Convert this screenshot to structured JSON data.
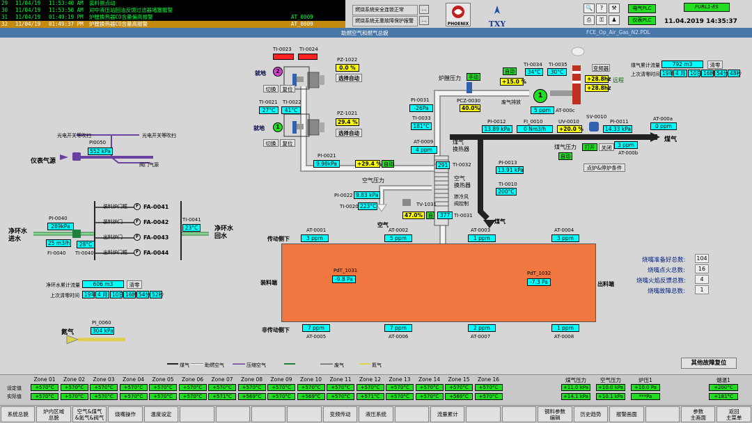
{
  "alarms": [
    {
      "n": "29",
      "date": "11/04/19",
      "time": "11:53:40 AM",
      "msg": "装料侧点动",
      "tag": ""
    },
    {
      "n": "30",
      "date": "11/04/19",
      "time": "11:53:50 AM",
      "msg": "对中液压站回油反馈过滤器堵塞报警",
      "tag": ""
    },
    {
      "n": "31",
      "date": "11/04/19",
      "time": "01:49:19 PM",
      "msg": "炉膛换热器CO含量偏高报警",
      "tag": "AT_0009"
    },
    {
      "n": "32",
      "date": "11/04/19",
      "time": "01:49:37 PM",
      "msg": "炉膛换热器CO含量高报警",
      "tag": "AT_0009"
    }
  ],
  "status_boxes": [
    "燃烧系统安全连锁正常",
    "燃烧系统无重故障保护报警"
  ],
  "dots": "...",
  "logo_left": "PHOENIX",
  "logo_right": "TXY",
  "plc": {
    "e": "电气PLC",
    "i": "仪表PLC"
  },
  "furl": "FURL1-ES",
  "datetime": "11.04.2019  14:35:37",
  "title": "助燃空气和燃气总貌",
  "pagecode": "FCE_Op_Air_Gas_N2.PDL",
  "burner_top": {
    "ti1": "TI-0023",
    "ti2": "TI-0024",
    "pz": "PZ-1022",
    "val": "0.0  %",
    "mode": "选择自动",
    "local": "就地",
    "num": "2",
    "b1": "切换",
    "b2": "复位"
  },
  "burner_mid": {
    "ti1": "TI-0021",
    "ti2": "TI-0022",
    "t1": "27°C",
    "t2": "41°C",
    "pz": "PZ-1021",
    "val": "29.4  %",
    "mode": "选择自动",
    "local": "就地",
    "num": "1",
    "b1": "切换",
    "b2": "复位"
  },
  "inst_air": {
    "pi": "PI0050",
    "val": "552  kPa",
    "label": "仪表气源",
    "l1": "光电开关等吹扫",
    "l2": "光电开关等吹扫",
    "l3": "阀门气源"
  },
  "water": {
    "pi": "PI-0040",
    "pval": "289kPa",
    "flow": "25  m3/h",
    "temp": "28°C",
    "fi": "FI-0040",
    "ti": "TI-0040",
    "ti2": "TI-0041",
    "t2": "23°C",
    "in": "净环水\n进水",
    "out": "净环水\n回水",
    "fa": [
      {
        "l": "装料炉门框",
        "t": "FA-0041"
      },
      {
        "l": "装料炉门",
        "t": "FA-0042"
      },
      {
        "l": "出料炉门",
        "t": "FA-0043"
      },
      {
        "l": "出料炉门框",
        "t": "FA-0044"
      }
    ],
    "acc_l": "净环水累计流量",
    "acc": "606  m3",
    "clear": "清零",
    "last_l": "上次清零时间",
    "last": [
      "19年",
      "4  月",
      "10日",
      "16时",
      "54分",
      "52秒"
    ]
  },
  "n2": {
    "pi": "PI_0060",
    "val": "304  kPa",
    "label": "氮气"
  },
  "air_main": {
    "pi21": "PI-0021",
    "v21": "9.98kPa",
    "pct": "+29.4 %",
    "auto": "自动",
    "air_p": "空气压力",
    "pi22": "PI-0022",
    "v22": "9.83 kPa",
    "ti20": "TI-0020",
    "v20": "223°C",
    "tv": "TV-1031",
    "tvv": "47.0%",
    "self": "自",
    "ti31": "TI-0031",
    "v31": "377",
    "air": "空气",
    "dilute": "掺冷风\n阀控制"
  },
  "furnace_p": {
    "l": "炉膛压力",
    "m": "手动",
    "pcz": "PCZ-0030",
    "v": "40.0%"
  },
  "pi31": {
    "t": "PI-0031",
    "v": "-26Pa"
  },
  "ti33": {
    "t": "TI-0033",
    "v": "181°C"
  },
  "at9": {
    "t": "AT-0009",
    "v": "4  ppm"
  },
  "hx": {
    "gas": "煤气\n换热器",
    "air": "空气\n换热器",
    "ti32": "TI-0032",
    "v32": "291"
  },
  "fan": {
    "auto": "自动",
    "pct": "+15.0 %",
    "ti34": "TI-0034",
    "v34": "34°C",
    "ti35": "TI-0035",
    "v35": "30°C",
    "exh": "废气排放",
    "ppm": "5  ppm",
    "at": "AT-000c",
    "num": "1"
  },
  "conv": {
    "l": "变频器",
    "h1": "+28.8hz",
    "h2": "+28.8hz",
    "r": "远程"
  },
  "gas_acc": {
    "l": "煤气累计流量",
    "v": "792  m3",
    "clear": "清零",
    "last_l": "上次清零时间",
    "last": [
      "19年",
      "4  月",
      "10日",
      "16时",
      "54分",
      "48秒"
    ]
  },
  "gas_line": {
    "pi12": "PI-0012",
    "v12": "13.89 kPa",
    "fi10": "FI_0010",
    "vf": "0 Nm3/h",
    "uv": "UV-0010",
    "vuv": "+20.0 %",
    "sv": "SV-0010",
    "pi11": "PI-0011",
    "v11": "14.33 kPa",
    "ata": "AT-000a",
    "va": "0  ppm",
    "atb": "AT-000b",
    "vb": "3  ppm",
    "gas": "煤气",
    "gp": "煤气压力",
    "auto": "自动",
    "open": "打开",
    "close": "关闭",
    "ign": "点炉&停炉条件",
    "pi13": "PI-0013",
    "v13": "13.91 kPa",
    "ti10": "TI-0010",
    "v10": "200°C",
    "gas2": "煤气"
  },
  "at_top": [
    {
      "t": "AT-0001",
      "v": "3  ppm"
    },
    {
      "t": "AT-0002",
      "v": "5  ppm"
    },
    {
      "t": "AT-0003",
      "v": "1  ppm"
    },
    {
      "t": "AT-0004",
      "v": "3  ppm"
    }
  ],
  "at_bot": [
    {
      "t": "AT-0005",
      "v": "7  ppm"
    },
    {
      "t": "AT-0006",
      "v": "7  ppm"
    },
    {
      "t": "AT-0007",
      "v": "2  ppm"
    },
    {
      "t": "AT-0008",
      "v": "1  ppm"
    }
  ],
  "furnace": {
    "drive": "传动侧下",
    "nondrive": "非传动侧下",
    "load": "装料端",
    "unload": "出料端",
    "pdt1": "PdT_1031",
    "p1": "-9.8 Pa",
    "pdt2": "PdT_1032",
    "p2": "-7.3 Pa"
  },
  "counts": [
    {
      "l": "烧嘴准备好总数:",
      "v": "104"
    },
    {
      "l": "烧嘴点火总数:",
      "v": "16"
    },
    {
      "l": "烧嘴火焰反馈总数:",
      "v": "4"
    },
    {
      "l": "烧嘴故障总数:",
      "v": "1"
    }
  ],
  "reset_all": "其他故障复位",
  "legend": [
    "煤气",
    "助燃空气",
    "压缩空气",
    "",
    "废气",
    "氮气"
  ],
  "zones": {
    "set_l": "设定值",
    "act_l": "实际值",
    "items": [
      {
        "h": "Zone 01",
        "s": "+570°C",
        "a": "+570°C"
      },
      {
        "h": "Zone 02",
        "s": "+570°C",
        "a": "+570°C"
      },
      {
        "h": "Zone 03",
        "s": "+570°C",
        "a": "+570°C"
      },
      {
        "h": "Zone 04",
        "s": "+570°C",
        "a": "+570°C"
      },
      {
        "h": "Zone 05",
        "s": "+570°C",
        "a": "+570°C"
      },
      {
        "h": "Zone 06",
        "s": "+570°C",
        "a": "+570°C"
      },
      {
        "h": "Zone 07",
        "s": "+570°C",
        "a": "+571°C"
      },
      {
        "h": "Zone 08",
        "s": "+570°C",
        "a": "+569°C"
      },
      {
        "h": "Zone 09",
        "s": "+570°C",
        "a": "+570°C"
      },
      {
        "h": "Zone 10",
        "s": "+570°C",
        "a": "+569°C"
      },
      {
        "h": "Zone 11",
        "s": "+570°C",
        "a": "+570°C"
      },
      {
        "h": "Zone 12",
        "s": "+570°C",
        "a": "+571°C"
      },
      {
        "h": "Zone 13",
        "s": "+570°C",
        "a": "+570°C"
      },
      {
        "h": "Zone 14",
        "s": "+570°C",
        "a": "+570°C"
      },
      {
        "h": "Zone 15",
        "s": "+570°C",
        "a": "+569°C"
      },
      {
        "h": "Zone 16",
        "s": "+570°C",
        "a": "+570°C"
      }
    ],
    "extra": [
      {
        "h": "煤气压力",
        "s": "+11.0 kPa",
        "a": "+14.1 kPa"
      },
      {
        "h": "空气压力",
        "s": "+10.0 kPa",
        "a": "+10.1 kPa"
      },
      {
        "h": "炉压1",
        "s": "+10.0 Pa",
        "a": "***Pa"
      },
      {
        "h": "烟温1",
        "s": "+200°C",
        "a": "+181°C"
      }
    ]
  },
  "nav": [
    "系统总貌",
    "炉内区域\n总貌",
    "空气&煤气\n&氮气&阀气",
    "烧嘴操作",
    "温度设定",
    "",
    "",
    "",
    "",
    "",
    "传动",
    "液压系统",
    "",
    "流量累计",
    "",
    "",
    "",
    "",
    "钢料参数\n编辑",
    "历史趋势",
    "报警画面",
    "",
    "参数\n主画面",
    "返回\n主菜单"
  ],
  "nav_fixed": [
    "系统总貌",
    "炉内区域\n总貌",
    "空气&煤气\n&氮气&阀气",
    "烧嘴操作",
    "温度设定",
    "",
    "",
    "",
    "",
    "变频传动",
    "液压系统",
    "",
    "流量累计",
    "",
    "",
    "钢料参数\n编辑",
    "历史趋势",
    "报警画面",
    "",
    "参数\n主画面",
    "返回\n主菜单"
  ]
}
